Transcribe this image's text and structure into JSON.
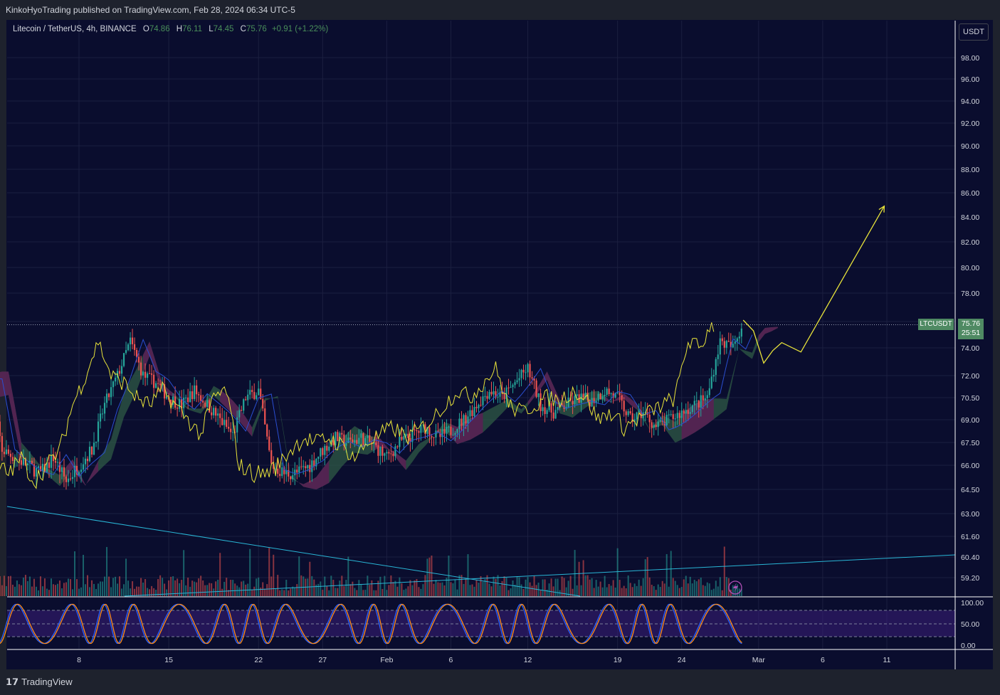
{
  "header": {
    "publisher_line": "KinkoHyoTrading published on TradingView.com, Feb 28, 2024 06:34 UTC-5"
  },
  "legend": {
    "symbol": "Litecoin / TetherUS, 4h, BINANCE",
    "o_label": "O",
    "o_value": "74.86",
    "h_label": "H",
    "h_value": "76.11",
    "l_label": "L",
    "l_value": "74.45",
    "c_label": "C",
    "c_value": "75.76",
    "change": "+0.91 (+1.22%)"
  },
  "currency_button": "USDT",
  "price_tag": {
    "symbol": "LTCUSDT",
    "price": "75.76",
    "countdown": "25:51"
  },
  "branding": "TradingView",
  "colors": {
    "background": "#0a0d2e",
    "price_line": "#e8e33a",
    "up": "#26a69a",
    "down": "#ef5350",
    "cloud_bull": "#2f5a45",
    "cloud_bear": "#5a1f55",
    "kijun": "#2a4fd1",
    "trendline": "#29b6d6"
  },
  "chart_data": {
    "type": "line",
    "title": "",
    "y_ticks": [
      "98.00",
      "96.00",
      "94.00",
      "92.00",
      "90.00",
      "88.00",
      "86.00",
      "84.00",
      "82.00",
      "80.00",
      "78.00",
      "76.00",
      "74.00",
      "72.00",
      "70.50",
      "69.00",
      "67.50",
      "66.00",
      "64.50",
      "63.00",
      "61.60",
      "60.40",
      "59.20"
    ],
    "y_tick_values": [
      98,
      96,
      94,
      92,
      90,
      88,
      86,
      84,
      82,
      80,
      78,
      76,
      74,
      72,
      70.5,
      69,
      67.5,
      66,
      64.5,
      63,
      61.6,
      60.4,
      59.2
    ],
    "osc_ticks": [
      "100.00",
      "50.00",
      "0.00"
    ],
    "osc_tick_values": [
      100,
      50,
      0
    ],
    "x_ticks": [
      "8",
      "15",
      "22",
      "27",
      "Feb",
      "6",
      "12",
      "19",
      "24",
      "Mar",
      "6",
      "11"
    ],
    "x_tick_days": [
      8,
      15,
      22,
      27,
      32,
      37,
      43,
      50,
      55,
      61,
      66,
      71
    ],
    "current_price": 75.76,
    "series": [
      {
        "role": "projection",
        "x": [
          59.8,
          60.6,
          61.4,
          62.1,
          62.8,
          64.3,
          70.8
        ],
        "y": [
          76.1,
          75.3,
          72.9,
          73.8,
          74.4,
          73.7,
          84.9
        ]
      }
    ]
  }
}
